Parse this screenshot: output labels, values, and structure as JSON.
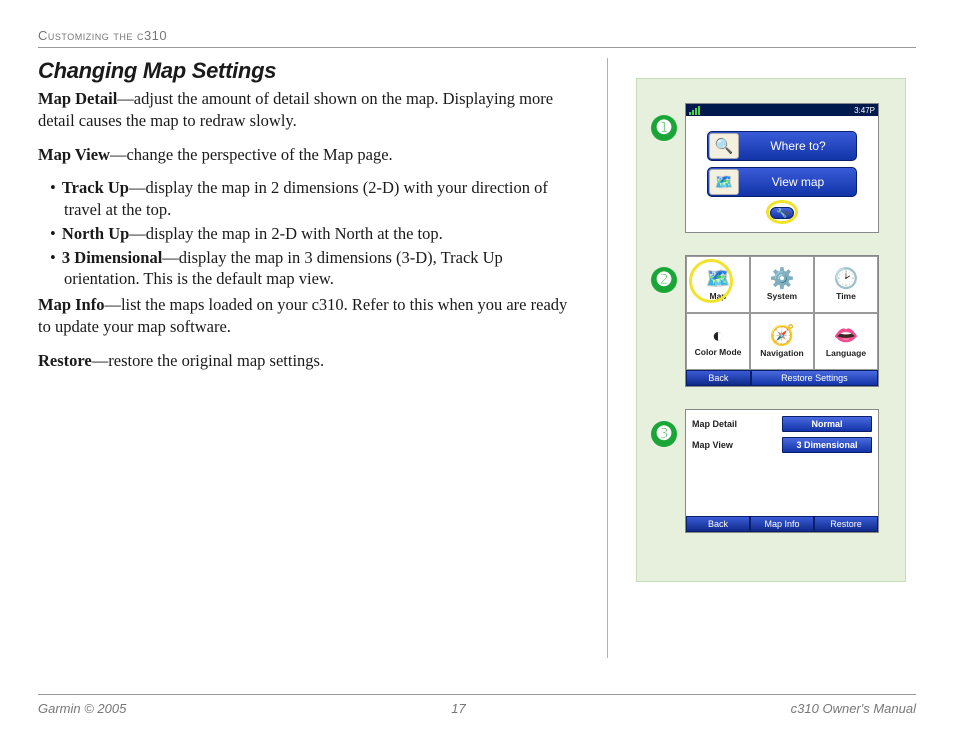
{
  "running_head": "Customizing the c310",
  "section_title": "Changing Map Settings",
  "paragraphs": {
    "map_detail_term": "Map Detail",
    "map_detail_rest": "—adjust the amount of detail shown on the map. Displaying more detail causes the map to redraw slowly.",
    "map_view_term": "Map View",
    "map_view_rest": "—change the perspective of the Map page.",
    "trackup_term": "Track Up",
    "trackup_rest": "—display the map in 2 dimensions (2-D) with your direction of travel at the top.",
    "northup_term": "North Up",
    "northup_rest": "—display the map in 2-D with North at the top.",
    "threed_term": "3 Dimensional",
    "threed_rest": "—display the map in 3 dimensions (3-D), Track Up orientation. This is the default map view.",
    "map_info_term": "Map Info",
    "map_info_rest": "—list the maps loaded on your c310. Refer to this when you are ready to update your map software.",
    "restore_term": "Restore",
    "restore_rest": "—restore the original map settings."
  },
  "badges": {
    "one": "➊",
    "two": "➋",
    "three": "➌"
  },
  "screenshot1": {
    "time": "3:47P",
    "where_to": "Where to?",
    "view_map": "View map",
    "wrench_glyph": "⟶",
    "brightness_glyph": "☀"
  },
  "screenshot2": {
    "cells": {
      "map": "Map",
      "system": "System",
      "time": "Time",
      "color": "Color Mode",
      "nav": "Navigation",
      "lang": "Language"
    },
    "back": "Back",
    "restore": "Restore Settings"
  },
  "screenshot3": {
    "row1_label": "Map Detail",
    "row1_value": "Normal",
    "row2_label": "Map View",
    "row2_value": "3 Dimensional",
    "back": "Back",
    "mapinfo": "Map Info",
    "restore": "Restore"
  },
  "footer": {
    "left": "Garmin © 2005",
    "center": "17",
    "right": "c310 Owner's Manual"
  }
}
